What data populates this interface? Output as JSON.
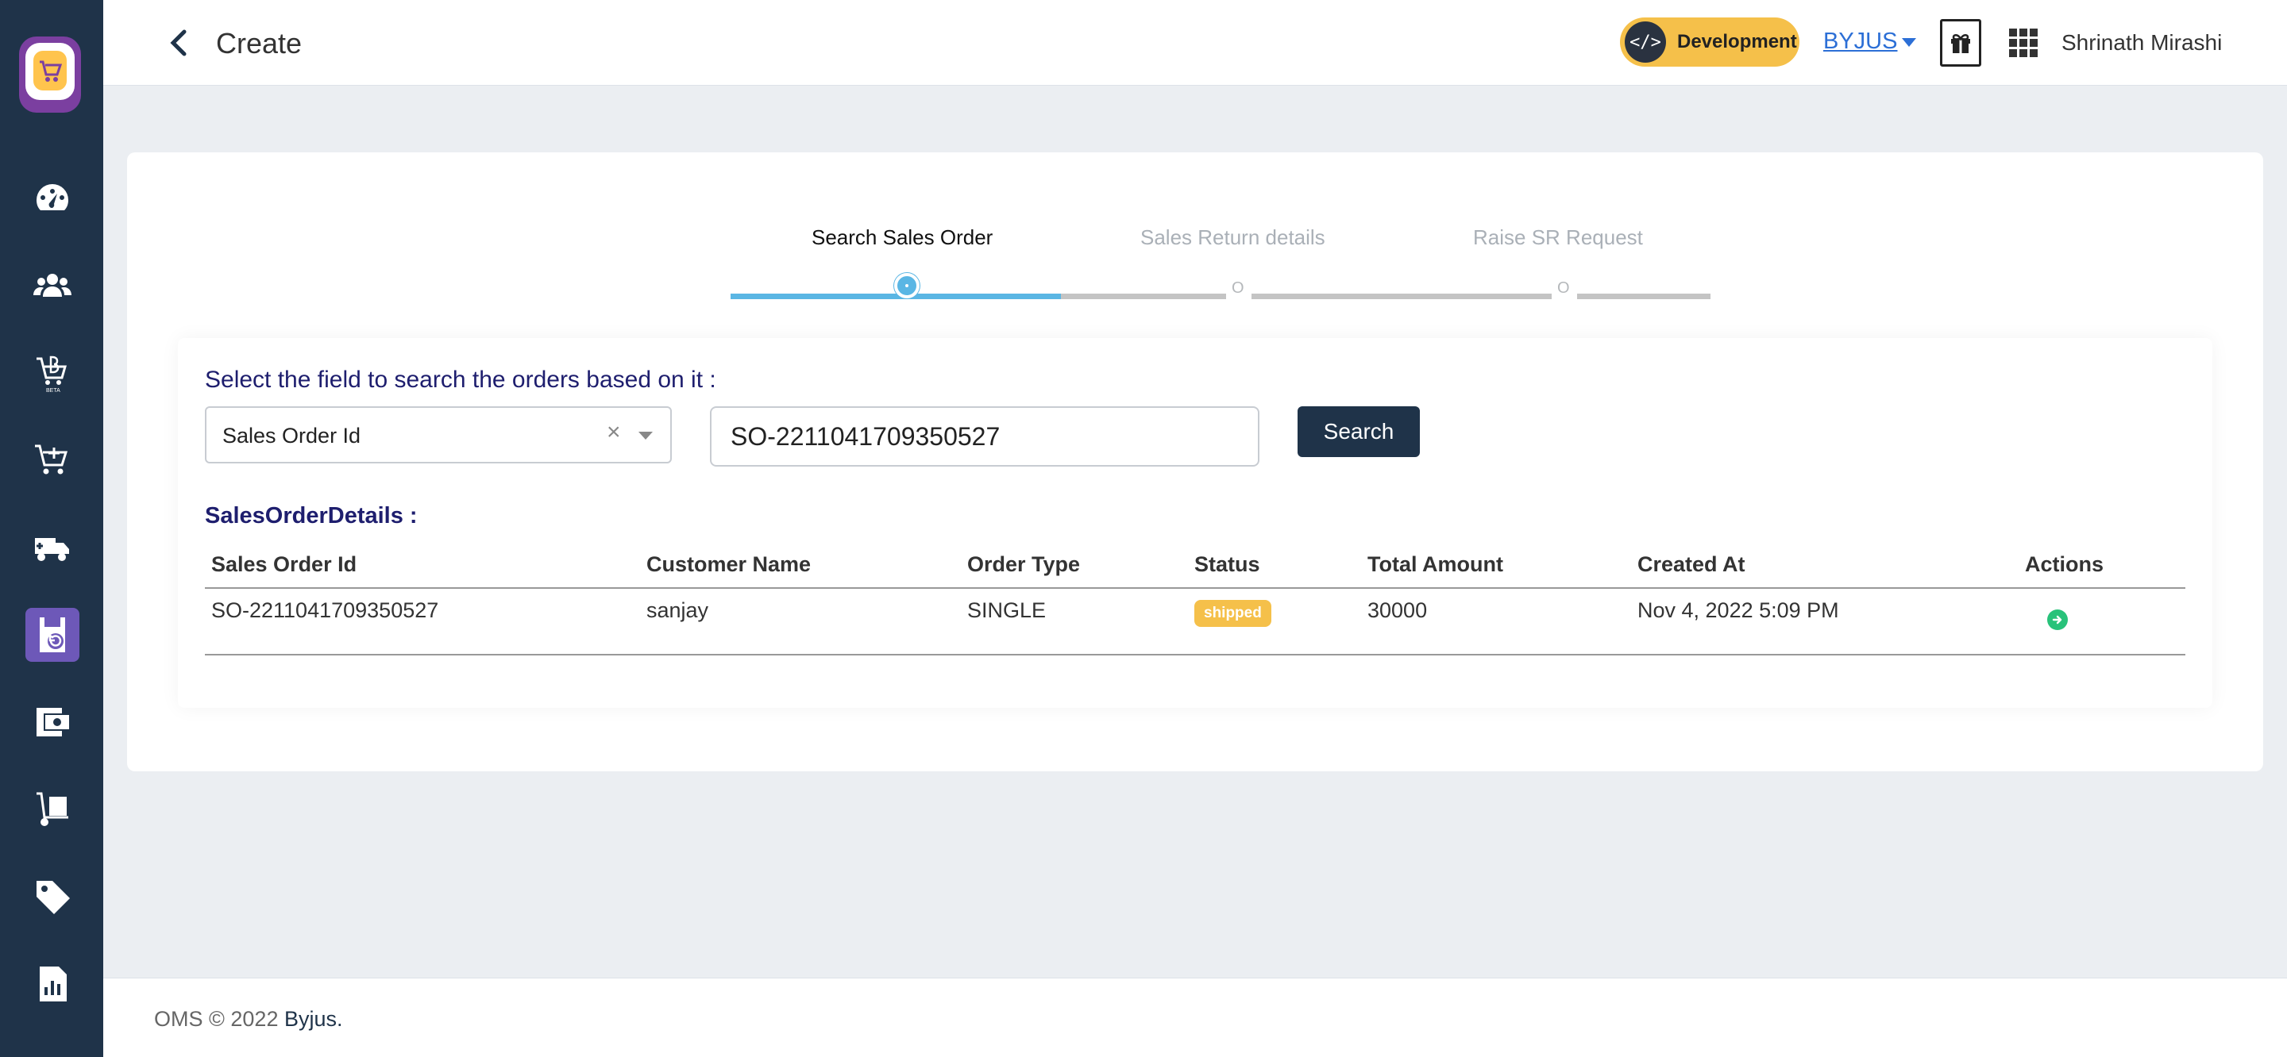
{
  "sidebar": {
    "items": [
      {
        "icon": "dashboard-icon"
      },
      {
        "icon": "users-icon"
      },
      {
        "icon": "beta-products-icon",
        "badge": "BETA"
      },
      {
        "icon": "add-to-cart-icon"
      },
      {
        "icon": "shipping-truck-icon"
      },
      {
        "icon": "sales-return-icon",
        "active": true
      },
      {
        "icon": "payments-icon"
      },
      {
        "icon": "warehouse-dolly-icon"
      },
      {
        "icon": "tag-icon"
      },
      {
        "icon": "reports-icon"
      }
    ]
  },
  "header": {
    "title": "Create",
    "environment": "Development",
    "tenant": "BYJUS",
    "user_name": "Shrinath Mirashi"
  },
  "stepper": {
    "steps": [
      {
        "label": "Search Sales Order",
        "state": "active"
      },
      {
        "label": "Sales Return details",
        "state": "pending"
      },
      {
        "label": "Raise SR Request",
        "state": "pending"
      }
    ],
    "progress_color": "#5ab6e4",
    "pending_color": "#c4c4c4"
  },
  "search": {
    "prompt": "Select the field to search the orders based on it :",
    "field_value": "Sales Order Id",
    "clear_symbol": "×",
    "query": "SO-2211041709350527",
    "button_label": "Search"
  },
  "results": {
    "title": "SalesOrderDetails :",
    "columns": [
      "Sales Order Id",
      "Customer Name",
      "Order Type",
      "Status",
      "Total Amount",
      "Created At",
      "Actions"
    ],
    "rows": [
      {
        "sales_order_id": "SO-2211041709350527",
        "customer_name": "sanjay",
        "order_type": "SINGLE",
        "status": "shipped",
        "total_amount": "30000",
        "created_at": "Nov 4, 2022 5:09 PM",
        "action_icon": "arrow-right-circle-icon"
      }
    ]
  },
  "footer": {
    "text": "OMS © 2022 ",
    "brand": "Byjus."
  },
  "colors": {
    "sidebar_bg": "#1f3349",
    "accent_yellow": "#f5c04a",
    "link_blue": "#2c6fd6",
    "action_green": "#28c27a",
    "active_nav": "#6d58b8"
  }
}
